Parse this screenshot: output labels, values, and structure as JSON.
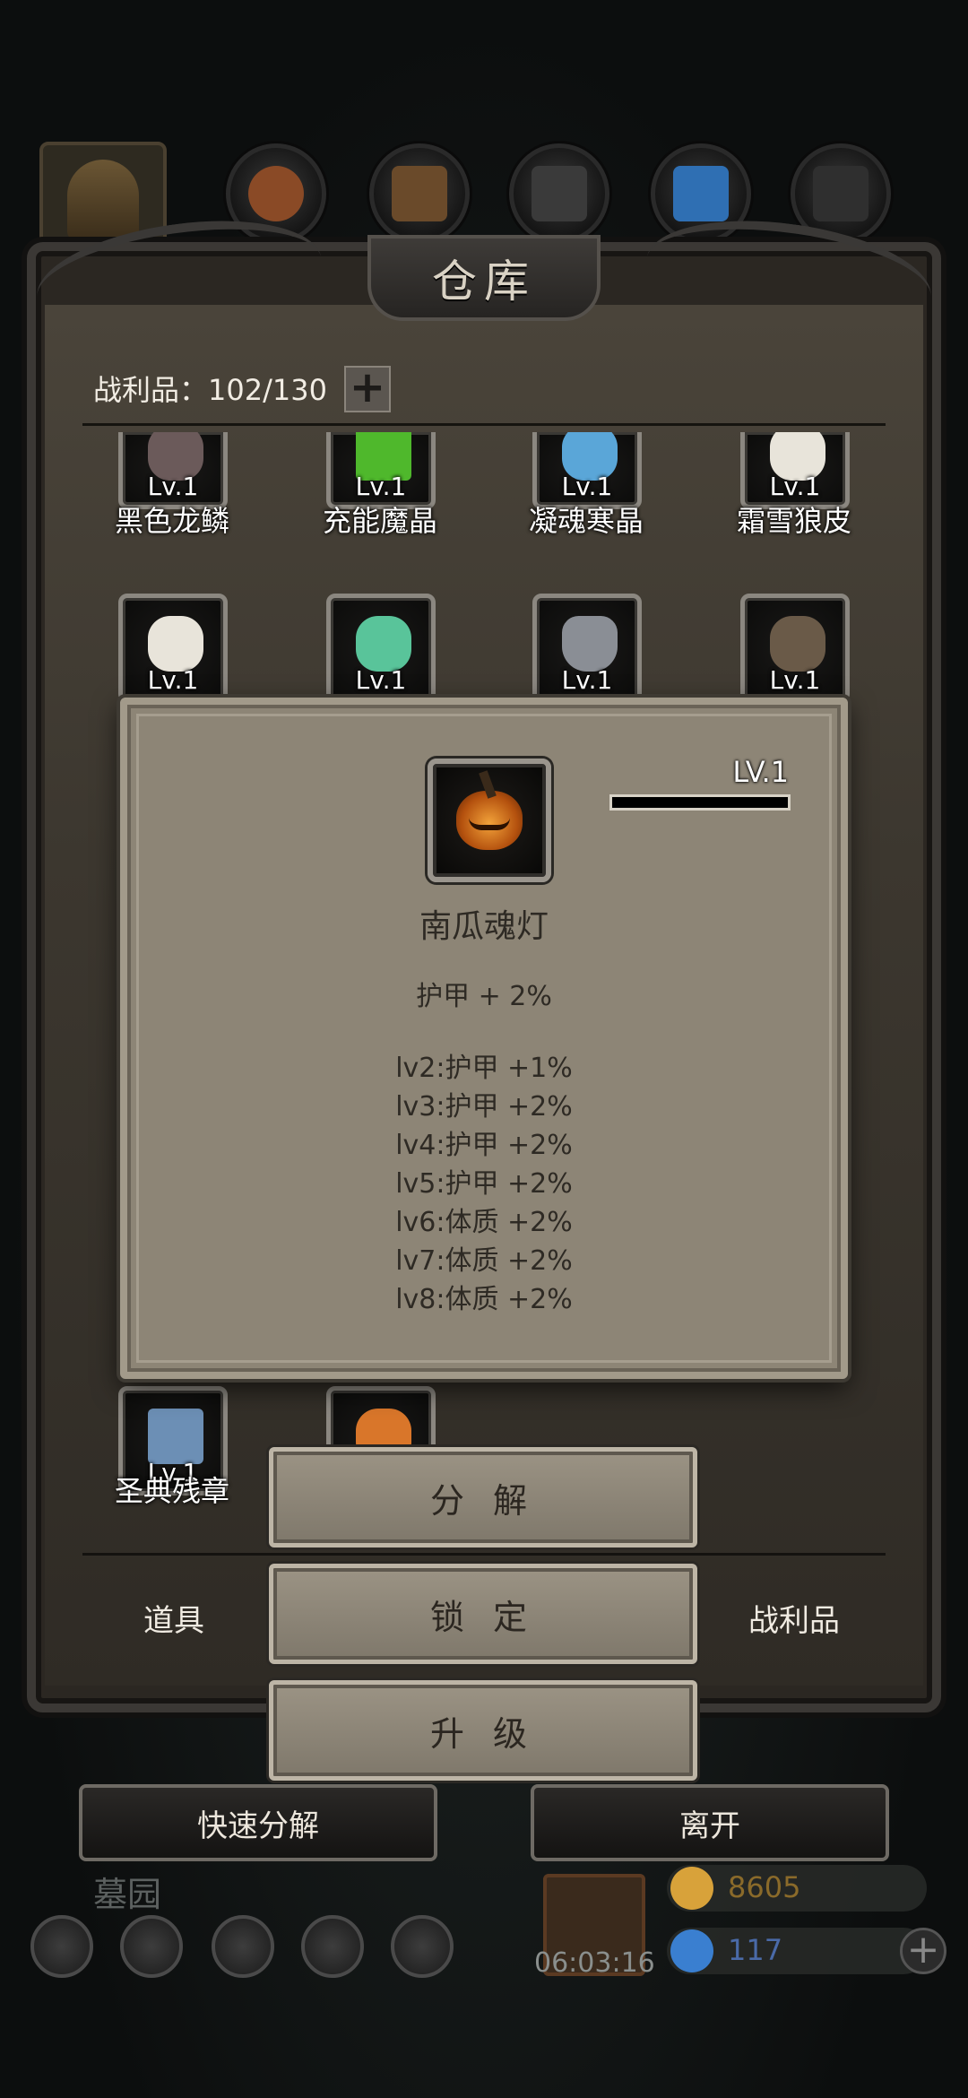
{
  "window": {
    "title": "仓库"
  },
  "category_tabs": [
    {
      "name": "helmet",
      "color": "#6b5634"
    },
    {
      "name": "ore",
      "color": "#8a4a26"
    },
    {
      "name": "wood",
      "color": "#6a4a2a"
    },
    {
      "name": "stone",
      "color": "#3a3a3a"
    },
    {
      "name": "crystal",
      "color": "#2f6fb3"
    },
    {
      "name": "iron",
      "color": "#2f2f2f"
    }
  ],
  "capacity": {
    "label": "战利品：102/130",
    "add_icon": "+"
  },
  "items": [
    {
      "lv": "Lv.1",
      "name": "黑色龙鳞",
      "color": "#6b5a5a"
    },
    {
      "lv": "Lv.1",
      "name": "充能魔晶",
      "color": "#4fb82c"
    },
    {
      "lv": "Lv.1",
      "name": "凝魂寒晶",
      "color": "#5aa6d8"
    },
    {
      "lv": "Lv.1",
      "name": "霜雪狼皮",
      "color": "#e8e4da"
    },
    {
      "lv": "Lv.1",
      "name": "",
      "color": "#e8e4da"
    },
    {
      "lv": "Lv.1",
      "name": "",
      "color": "#59c49a"
    },
    {
      "lv": "Lv.1",
      "name": "",
      "color": "#8a8e95"
    },
    {
      "lv": "Lv.1",
      "name": "",
      "color": "#6a5a48"
    },
    {
      "lv": "Lv.1",
      "name": "圣典残章",
      "color": "#6c8fb5"
    },
    {
      "lv": "",
      "name": "",
      "color": "#d9762a"
    }
  ],
  "bottom_tabs": {
    "left": "道具",
    "right": "战利品"
  },
  "outer_buttons": {
    "quick_decompose": "快速分解",
    "leave": "离开"
  },
  "hud": {
    "location": "墓园",
    "timer": "06:03:16",
    "gold": "8605",
    "gems": "117",
    "plus": "+"
  },
  "popup": {
    "level": "LV.1",
    "xp_fraction": 0.0,
    "item_name": "南瓜魂灯",
    "stat": "护甲 + 2%",
    "level_bonuses": [
      "lv2:护甲 +1%",
      "lv3:护甲 +2%",
      "lv4:护甲 +2%",
      "lv5:护甲 +2%",
      "lv6:体质 +2%",
      "lv7:体质 +2%",
      "lv8:体质 +2%"
    ]
  },
  "actions": {
    "decompose": "分 解",
    "lock": "锁 定",
    "upgrade": "升 级"
  },
  "colors": {
    "gold_icon": "#d8a23a",
    "gem_icon": "#3a7fd0",
    "gold_text": "#8a6a2a",
    "gem_text": "#4a6aa8"
  }
}
